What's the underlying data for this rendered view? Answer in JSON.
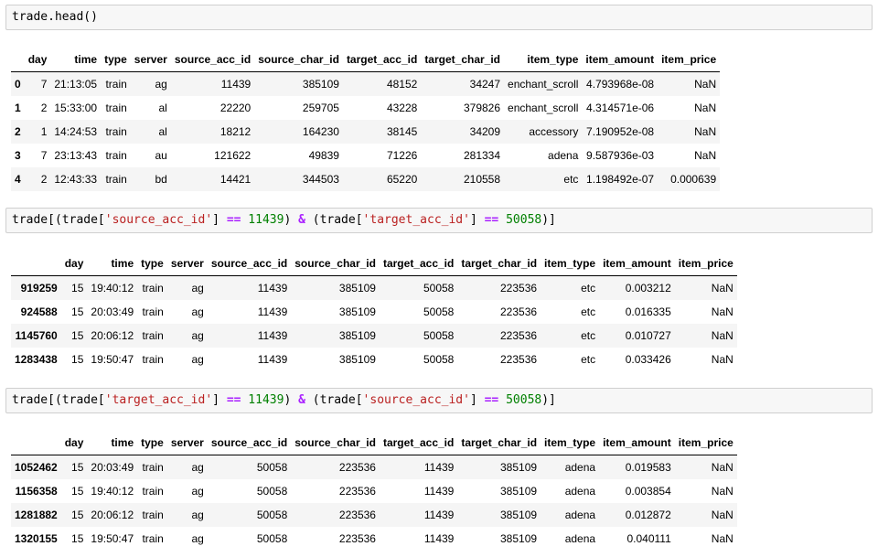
{
  "cells": [
    {
      "code": {
        "plain": "trade.head()"
      },
      "table": {
        "columns": [
          "day",
          "time",
          "type",
          "server",
          "source_acc_id",
          "source_char_id",
          "target_acc_id",
          "target_char_id",
          "item_type",
          "item_amount",
          "item_price"
        ],
        "rows": [
          {
            "index": "0",
            "values": [
              "7",
              "21:13:05",
              "train",
              "ag",
              "11439",
              "385109",
              "48152",
              "34247",
              "enchant_scroll",
              "4.793968e-08",
              "NaN"
            ]
          },
          {
            "index": "1",
            "values": [
              "2",
              "15:33:00",
              "train",
              "al",
              "22220",
              "259705",
              "43228",
              "379826",
              "enchant_scroll",
              "4.314571e-06",
              "NaN"
            ]
          },
          {
            "index": "2",
            "values": [
              "1",
              "14:24:53",
              "train",
              "al",
              "18212",
              "164230",
              "38145",
              "34209",
              "accessory",
              "7.190952e-08",
              "NaN"
            ]
          },
          {
            "index": "3",
            "values": [
              "7",
              "23:13:43",
              "train",
              "au",
              "121622",
              "49839",
              "71226",
              "281334",
              "adena",
              "9.587936e-03",
              "NaN"
            ]
          },
          {
            "index": "4",
            "values": [
              "2",
              "12:43:33",
              "train",
              "bd",
              "14421",
              "344503",
              "65220",
              "210558",
              "etc",
              "1.198492e-07",
              "0.000639"
            ]
          }
        ]
      }
    },
    {
      "code": {
        "p1": "trade[(trade[",
        "s1": "'source_acc_id'",
        "p2": "] ",
        "o1": "==",
        "p3": " ",
        "n1": "11439",
        "p4": ") ",
        "o2": "&",
        "p5": " (trade[",
        "s2": "'target_acc_id'",
        "p6": "] ",
        "o3": "==",
        "p7": " ",
        "n2": "50058",
        "p8": ")]"
      },
      "table": {
        "columns": [
          "day",
          "time",
          "type",
          "server",
          "source_acc_id",
          "source_char_id",
          "target_acc_id",
          "target_char_id",
          "item_type",
          "item_amount",
          "item_price"
        ],
        "rows": [
          {
            "index": "919259",
            "values": [
              "15",
              "19:40:12",
              "train",
              "ag",
              "11439",
              "385109",
              "50058",
              "223536",
              "etc",
              "0.003212",
              "NaN"
            ]
          },
          {
            "index": "924588",
            "values": [
              "15",
              "20:03:49",
              "train",
              "ag",
              "11439",
              "385109",
              "50058",
              "223536",
              "etc",
              "0.016335",
              "NaN"
            ]
          },
          {
            "index": "1145760",
            "values": [
              "15",
              "20:06:12",
              "train",
              "ag",
              "11439",
              "385109",
              "50058",
              "223536",
              "etc",
              "0.010727",
              "NaN"
            ]
          },
          {
            "index": "1283438",
            "values": [
              "15",
              "19:50:47",
              "train",
              "ag",
              "11439",
              "385109",
              "50058",
              "223536",
              "etc",
              "0.033426",
              "NaN"
            ]
          }
        ]
      }
    },
    {
      "code": {
        "p1": "trade[(trade[",
        "s1": "'target_acc_id'",
        "p2": "] ",
        "o1": "==",
        "p3": " ",
        "n1": "11439",
        "p4": ") ",
        "o2": "&",
        "p5": " (trade[",
        "s2": "'source_acc_id'",
        "p6": "] ",
        "o3": "==",
        "p7": " ",
        "n2": "50058",
        "p8": ")]"
      },
      "table": {
        "columns": [
          "day",
          "time",
          "type",
          "server",
          "source_acc_id",
          "source_char_id",
          "target_acc_id",
          "target_char_id",
          "item_type",
          "item_amount",
          "item_price"
        ],
        "rows": [
          {
            "index": "1052462",
            "values": [
              "15",
              "20:03:49",
              "train",
              "ag",
              "50058",
              "223536",
              "11439",
              "385109",
              "adena",
              "0.019583",
              "NaN"
            ]
          },
          {
            "index": "1156358",
            "values": [
              "15",
              "19:40:12",
              "train",
              "ag",
              "50058",
              "223536",
              "11439",
              "385109",
              "adena",
              "0.003854",
              "NaN"
            ]
          },
          {
            "index": "1281882",
            "values": [
              "15",
              "20:06:12",
              "train",
              "ag",
              "50058",
              "223536",
              "11439",
              "385109",
              "adena",
              "0.012872",
              "NaN"
            ]
          },
          {
            "index": "1320155",
            "values": [
              "15",
              "19:50:47",
              "train",
              "ag",
              "50058",
              "223536",
              "11439",
              "385109",
              "adena",
              "0.040111",
              "NaN"
            ]
          }
        ]
      }
    }
  ]
}
